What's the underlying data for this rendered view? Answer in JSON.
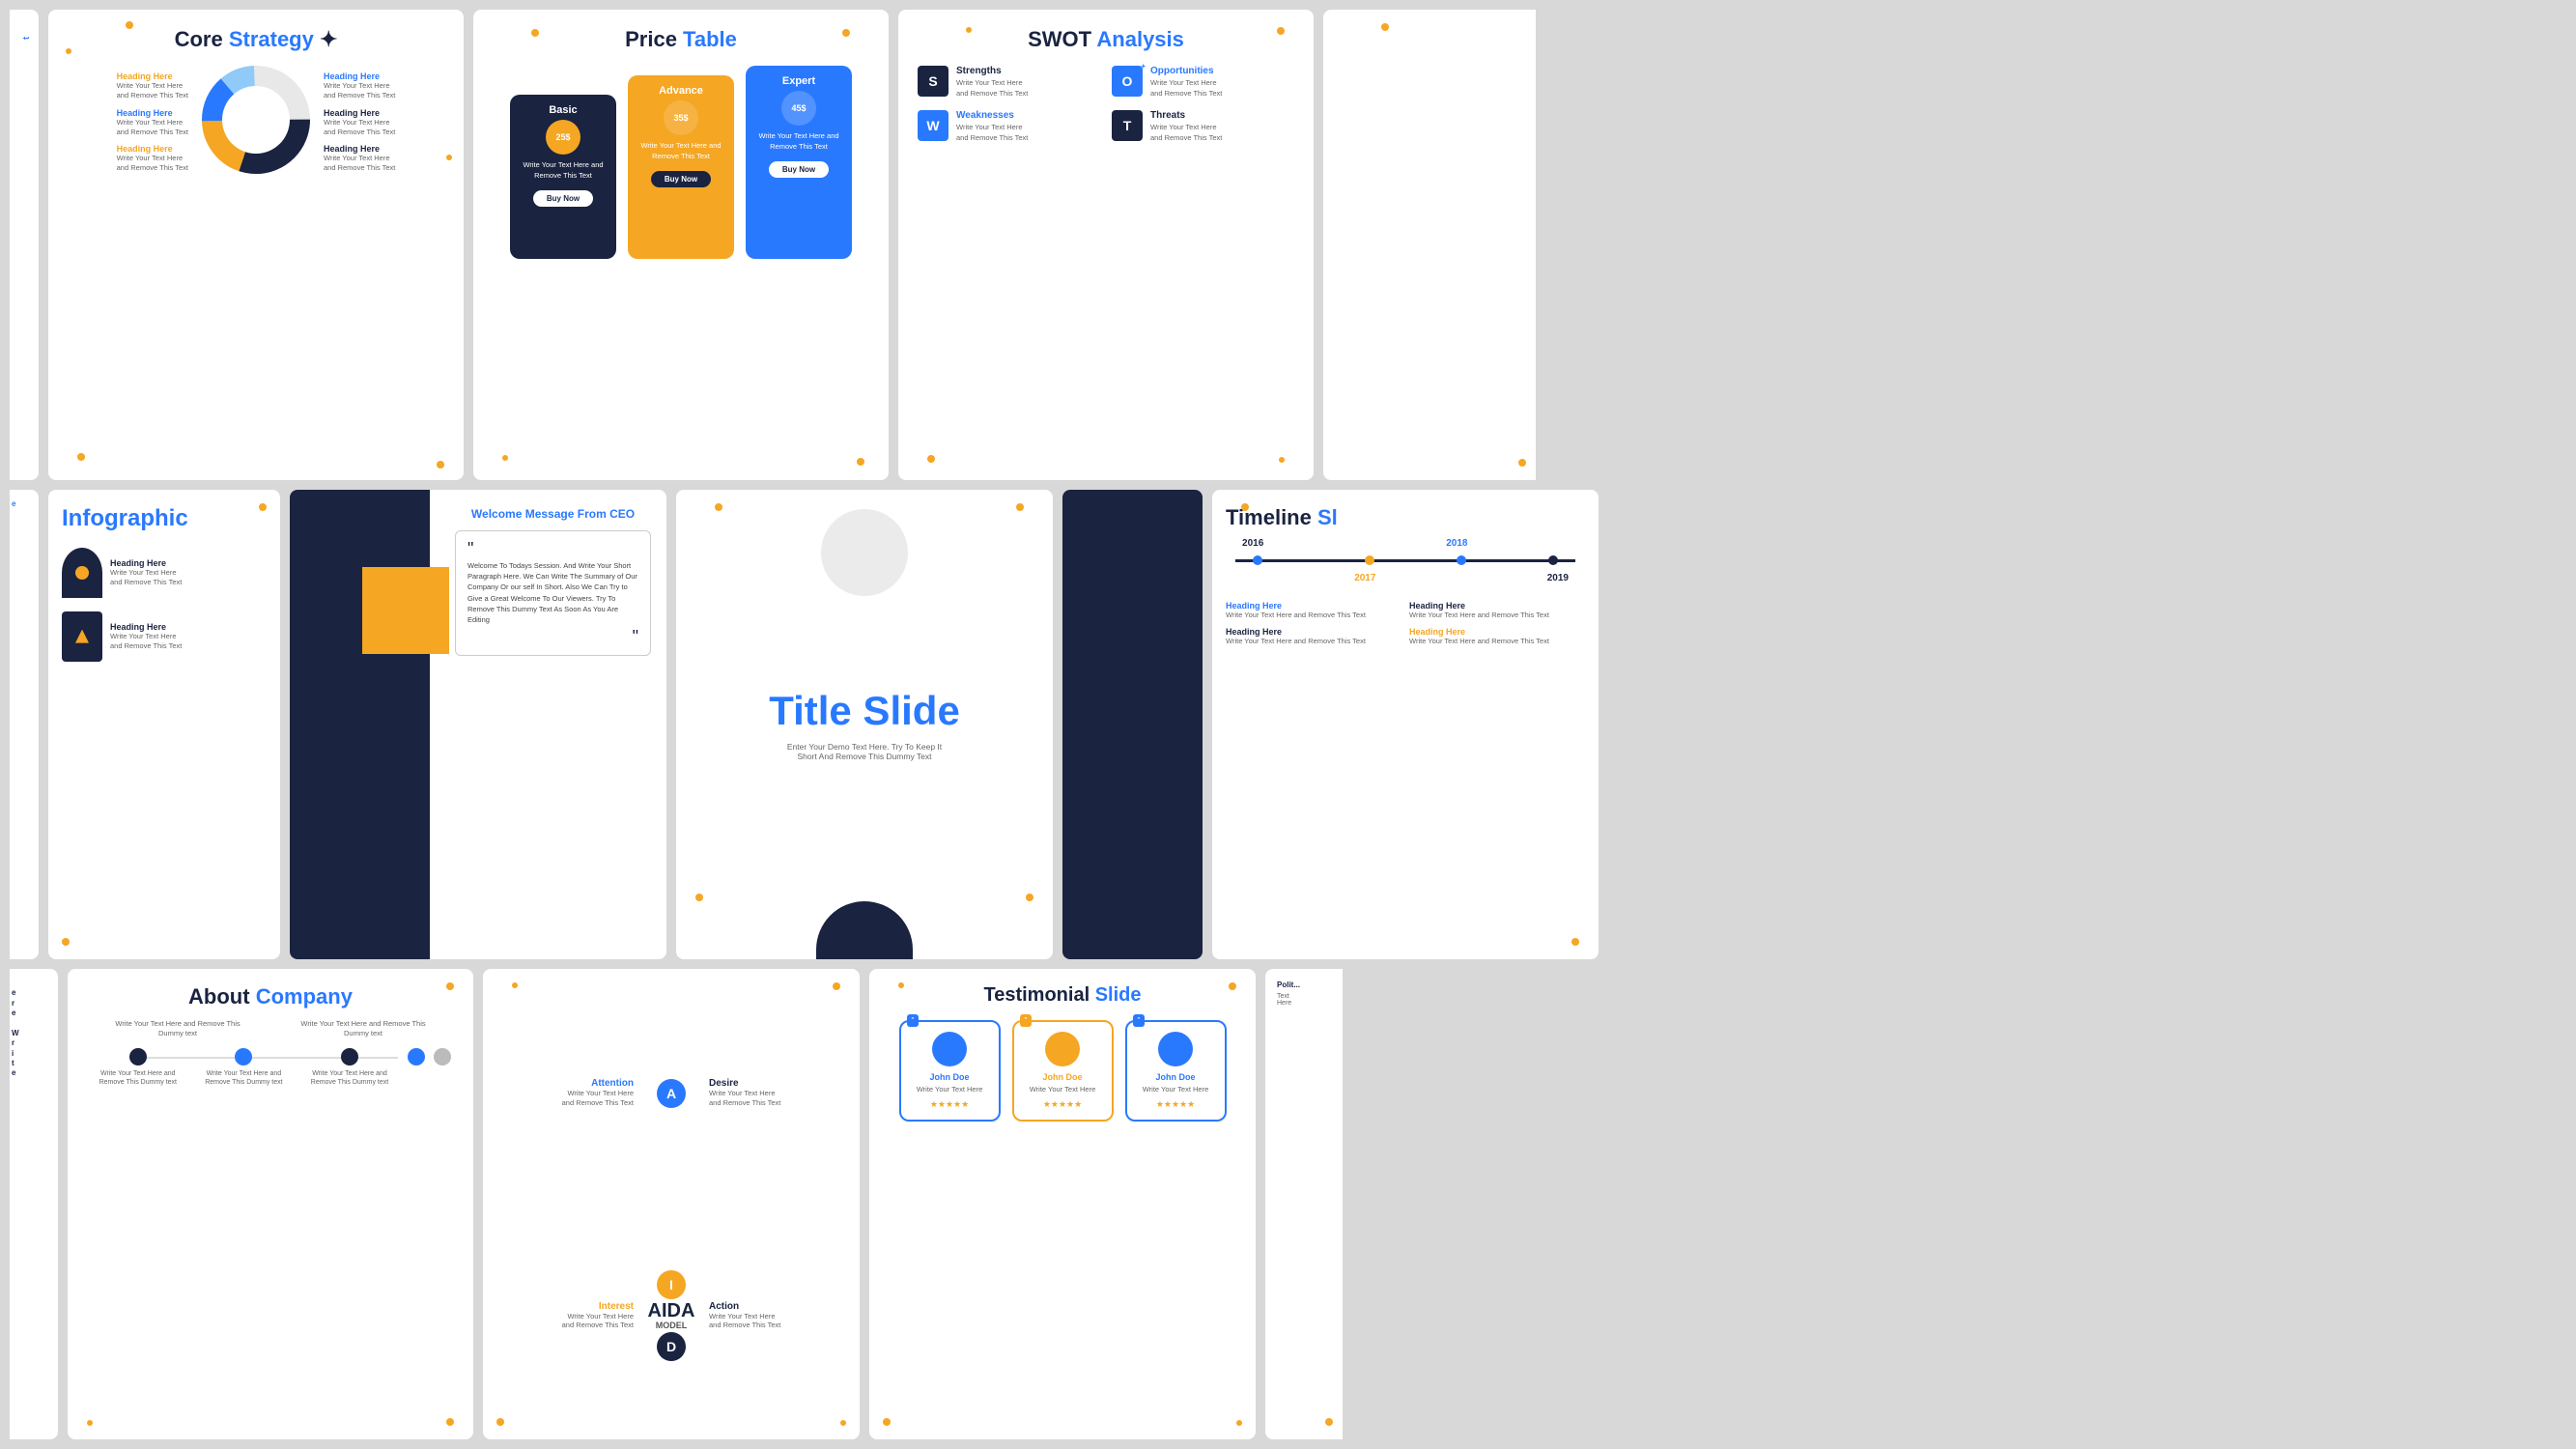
{
  "slides": {
    "core_strategy": {
      "title": "Core",
      "title_colored": "Strategy",
      "headings": [
        {
          "label": "Heading Here",
          "text": "Write Your Text Here and Remove This Text",
          "color": "gold"
        },
        {
          "label": "Heading Here",
          "text": "Write Your Text Here and Remove This Text",
          "color": "blue"
        },
        {
          "label": "Heading Here",
          "text": "Write Your Text Here and Remove This Text",
          "color": "gold"
        },
        {
          "label": "Heading Here",
          "text": "Write Your Text Here and Remove This Text",
          "color": "blue"
        },
        {
          "label": "Heading Here",
          "text": "Write Your Text Here and Remove This Text",
          "color": "navy"
        },
        {
          "label": "Heading Here",
          "text": "Write Your Text Here and Remove This Text",
          "color": "navy"
        }
      ]
    },
    "price_table": {
      "title": "Price",
      "title_colored": "Table",
      "cards": [
        {
          "name": "Basic",
          "price": "25$",
          "text": "Write Your Text Here and Remove This Text",
          "btn": "Buy Now",
          "type": "basic"
        },
        {
          "name": "Advance",
          "price": "35$",
          "text": "Write Your Text Here and Remove This Text",
          "btn": "Buy Now",
          "type": "advance"
        },
        {
          "name": "Expert",
          "price": "45$",
          "text": "Write Your Text Here and Remove This Text",
          "btn": "Buy Now",
          "type": "expert"
        }
      ]
    },
    "swot": {
      "title": "SWOT",
      "title_colored": "Analysis",
      "items": [
        {
          "letter": "S",
          "label": "Strengths",
          "text": "Write Your Text Here and Remove This Text",
          "color": "s"
        },
        {
          "letter": "O",
          "label": "Opportunities",
          "text": "Write Your Text Here and Remove This Text",
          "color": "o"
        },
        {
          "letter": "W",
          "label": "Weaknesses",
          "text": "Write Your Text Here and Remove This Text",
          "color": "w"
        },
        {
          "letter": "T",
          "label": "Threats",
          "text": "Write Your Text Here and Remove This Text",
          "color": "t"
        }
      ]
    },
    "infographic": {
      "title": "Infographic",
      "items": [
        {
          "heading": "Heading Here",
          "text": "Write Your Text Here and Remove This Text"
        },
        {
          "heading": "Heading Here",
          "text": "Write Your Text Here and Remove This Text"
        }
      ]
    },
    "ceo": {
      "title": "Welcome Message From CEO",
      "quote": "Welcome To Todays Session. And Write Your Short Paragraph Here. We Can Write The Summary of Our Company Or our self In Short. Also We Can Try to Give a Great Welcome To Our Viewers. Try To Remove This Dummy Text As Soon As You Are Editing"
    },
    "title_slide": {
      "main_title": "Title Slide",
      "sub_text": "Enter Your Demo Text Here. Try To Keep It Short And Remove This Dummy Text"
    },
    "timeline": {
      "title": "Timeline",
      "title_colored": "Sl",
      "years": [
        "2016",
        "2017",
        "2018",
        "2019"
      ],
      "headings": [
        {
          "label": "Heading Here",
          "text": "Write Your Text Here and Remove This Text"
        },
        {
          "label": "Heading Here",
          "text": "Write Your Text Here and Remove This Text"
        },
        {
          "label": "Heading Here",
          "text": "Write Your Text Here and Remove This Text"
        },
        {
          "label": "Heading Here",
          "text": "Write Your Text Here and Remove This Text"
        }
      ]
    },
    "about": {
      "title": "About",
      "title_colored": "Company",
      "text_items": [
        "Write Your Text Here and Remove This Dummy text",
        "Write Your Text Here and Remove This Dummy text"
      ],
      "timeline_items": [
        "Write Your Text Here and Remove This Dummy text",
        "Write Your Text Here and Remove This Dummy text",
        "Write Your Text Here and Remove This Dummy text"
      ]
    },
    "aida": {
      "model_title": "AIDA",
      "model_subtitle": "MODEL",
      "items": [
        {
          "label": "Attention",
          "letter": "A",
          "text": "Write Your Text Here and Remove This Text",
          "side": "left",
          "row": 1
        },
        {
          "label": "Desire",
          "letter": "D",
          "text": "Write Your Text Here and Remove This Text",
          "side": "right",
          "row": 1
        },
        {
          "label": "Interest",
          "letter": "I",
          "text": "Write Your Text Here and Remove This Text",
          "side": "left",
          "row": 2
        },
        {
          "label": "Action",
          "letter": "A",
          "text": "Write Your Text Here and Remove This Text",
          "side": "right",
          "row": 2
        }
      ]
    },
    "testimonial": {
      "title": "Testimonial",
      "title_colored": "Slide",
      "cards": [
        {
          "name": "John Doe",
          "text": "Write Your Text Here",
          "stars": "★★★★★",
          "color": "blue"
        },
        {
          "name": "John Doe",
          "text": "Write Your Text Here",
          "stars": "★★★★★",
          "color": "gold"
        },
        {
          "name": "John Doe",
          "text": "Write Your Text Here",
          "stars": "★★★★★",
          "color": "blue"
        }
      ]
    }
  }
}
